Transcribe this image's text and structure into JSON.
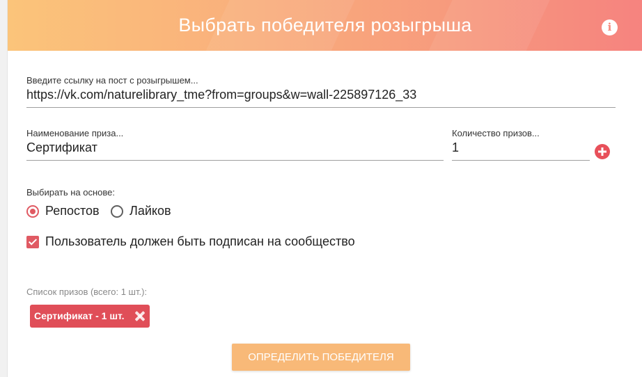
{
  "header": {
    "title": "Выбрать победителя розыгрыша",
    "info_icon_glyph": "i",
    "info_icon": "info-circle-icon",
    "gradient_colors": [
      "#fbc47a",
      "#f6837f"
    ]
  },
  "form": {
    "post_link": {
      "label": "Введите ссылку на пост с розыгрышем...",
      "value": "https://vk.com/naturelibrary_tme?from=groups&w=wall-225897126_33"
    },
    "prize_name": {
      "label": "Наименование приза...",
      "value": "Сертификат"
    },
    "prize_count": {
      "label": "Количество призов...",
      "value": "1"
    },
    "add_prize_icon": "plus-circle-icon",
    "basis": {
      "label": "Выбирать на основе:",
      "options": [
        {
          "label": "Репостов",
          "selected": true
        },
        {
          "label": "Лайков",
          "selected": false
        }
      ]
    },
    "subscribed_check": {
      "label": "Пользователь должен быть подписан на сообщество",
      "checked": true
    }
  },
  "prizes": {
    "list_label": "Список призов (всего: 1 шт.):",
    "items": [
      {
        "label": "Сертификат - 1 шт.",
        "remove_icon": "close-icon"
      }
    ]
  },
  "actions": {
    "submit_label": "ОПРЕДЕЛИТЬ ПОБЕДИТЕЛЯ"
  },
  "colors": {
    "accent": "#e05a63",
    "chip": "#e04e58",
    "button": "#f8b978"
  }
}
